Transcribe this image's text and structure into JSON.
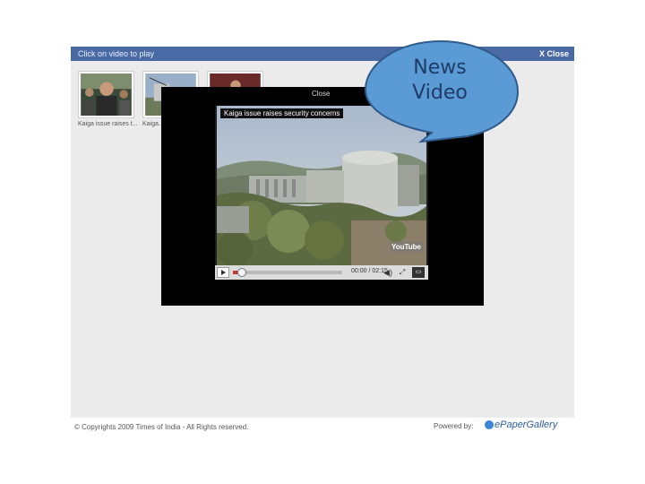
{
  "gallery": {
    "header_title": "Click on video to play",
    "close_label": "X Close",
    "thumbnails": [
      {
        "caption": "Kaiga issue raises t..."
      },
      {
        "caption": "Kaiga..."
      },
      {
        "caption": ""
      }
    ]
  },
  "player": {
    "close_label": "Close",
    "video_caption": "Kaiga issue raises security concerns",
    "watermark": "YouTube",
    "time": "00:00 / 02:15",
    "progress_fraction": 0.08,
    "fullscreen_label": "▭"
  },
  "callout": {
    "line1": "News",
    "line2": "Video"
  },
  "footer": {
    "copyright": "© Copyrights 2009 Times of India - All Rights reserved.",
    "powered_by": "Powered by:",
    "logo_text": "ePaperGallery"
  },
  "icons": {
    "play": "play-icon",
    "volume": "volume-icon",
    "expand": "expand-icon",
    "fullscreen": "fullscreen-icon"
  },
  "colors": {
    "header_bar": "#4a6aa6",
    "bubble_fill": "#5b9bd5",
    "bubble_stroke": "#2e5a8c"
  }
}
